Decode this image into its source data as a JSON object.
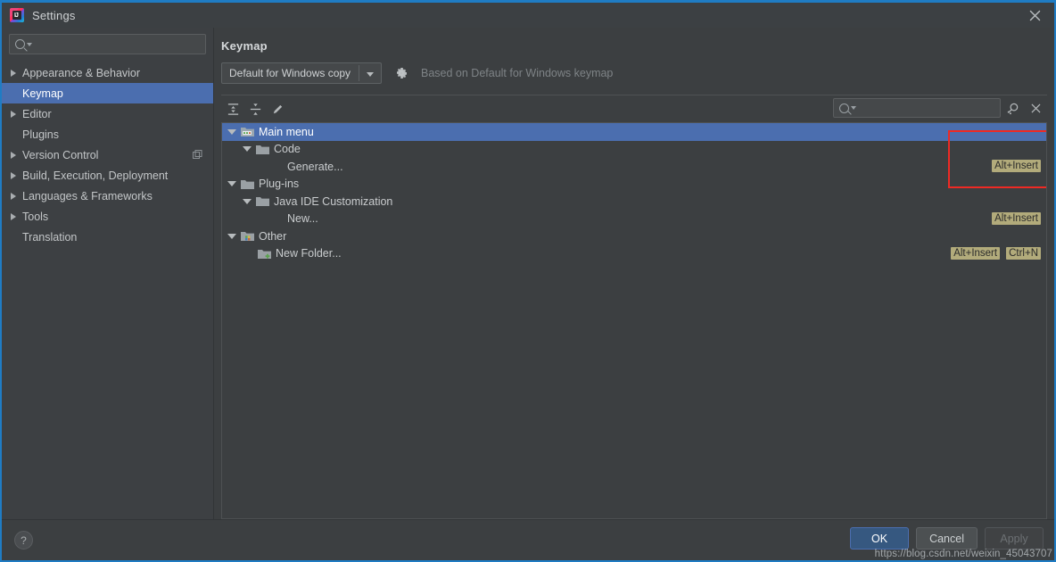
{
  "window": {
    "title": "Settings",
    "app_icon": "intellij-idea-icon",
    "close_icon": "close-icon",
    "accent_color": "#1f7cc4",
    "background_color": "#3c3f41",
    "selection_color": "#4b6eaf"
  },
  "sidebar": {
    "search": {
      "value": "",
      "placeholder": "",
      "icon": "search-icon"
    },
    "items": [
      {
        "label": "Appearance & Behavior",
        "expandable": true,
        "selected": false,
        "trailing_icon": ""
      },
      {
        "label": "Keymap",
        "expandable": false,
        "selected": true,
        "trailing_icon": ""
      },
      {
        "label": "Editor",
        "expandable": true,
        "selected": false,
        "trailing_icon": ""
      },
      {
        "label": "Plugins",
        "expandable": false,
        "selected": false,
        "trailing_icon": ""
      },
      {
        "label": "Version Control",
        "expandable": true,
        "selected": false,
        "trailing_icon": "copy-icon"
      },
      {
        "label": "Build, Execution, Deployment",
        "expandable": true,
        "selected": false,
        "trailing_icon": ""
      },
      {
        "label": "Languages & Frameworks",
        "expandable": true,
        "selected": false,
        "trailing_icon": ""
      },
      {
        "label": "Tools",
        "expandable": true,
        "selected": false,
        "trailing_icon": ""
      },
      {
        "label": "Translation",
        "expandable": false,
        "selected": false,
        "trailing_icon": ""
      }
    ]
  },
  "main": {
    "pane_title": "Keymap",
    "keymap_select": {
      "value": "Default for Windows copy",
      "caret_icon": "chevron-down-icon"
    },
    "gear_icon": "gear-icon",
    "based_on_note": "Based on Default for Windows keymap",
    "toolbar": {
      "expand_all_icon": "expand-all-icon",
      "collapse_all_icon": "collapse-all-icon",
      "edit_icon": "pencil-edit-icon",
      "search": {
        "value": "",
        "placeholder": "",
        "icon": "search-icon"
      },
      "find_by_shortcut_icon": "find-by-shortcut-icon",
      "clear_icon": "close-icon"
    },
    "tree": [
      {
        "label": "Main menu",
        "depth": 0,
        "expandable": true,
        "selected": true,
        "icon": "folder-menu-icon",
        "shortcuts": []
      },
      {
        "label": "Code",
        "depth": 1,
        "expandable": true,
        "selected": false,
        "icon": "folder-icon",
        "shortcuts": []
      },
      {
        "label": "Generate...",
        "depth": 2,
        "expandable": false,
        "selected": false,
        "icon": "",
        "shortcuts": [
          "Alt+Insert"
        ]
      },
      {
        "label": "Plug-ins",
        "depth": 0,
        "expandable": true,
        "selected": false,
        "icon": "folder-icon",
        "shortcuts": []
      },
      {
        "label": "Java IDE Customization",
        "depth": 1,
        "expandable": true,
        "selected": false,
        "icon": "folder-icon",
        "shortcuts": []
      },
      {
        "label": "New...",
        "depth": 2,
        "expandable": false,
        "selected": false,
        "icon": "",
        "shortcuts": [
          "Alt+Insert"
        ]
      },
      {
        "label": "Other",
        "depth": 0,
        "expandable": true,
        "selected": false,
        "icon": "folder-other-icon",
        "shortcuts": []
      },
      {
        "label": "New Folder...",
        "depth": 1,
        "expandable": false,
        "selected": false,
        "icon": "folder-add-icon",
        "shortcuts": [
          "Alt+Insert",
          "Ctrl+N"
        ]
      }
    ],
    "shortcut_badge_color": "#b2ab7b",
    "annotation": {
      "type": "red-rectangle",
      "color": "#ee2a24"
    }
  },
  "footer": {
    "help_label": "?",
    "ok_label": "OK",
    "cancel_label": "Cancel",
    "apply_label": "Apply",
    "apply_disabled": true
  },
  "watermark": "https://blog.csdn.net/weixin_45043707"
}
